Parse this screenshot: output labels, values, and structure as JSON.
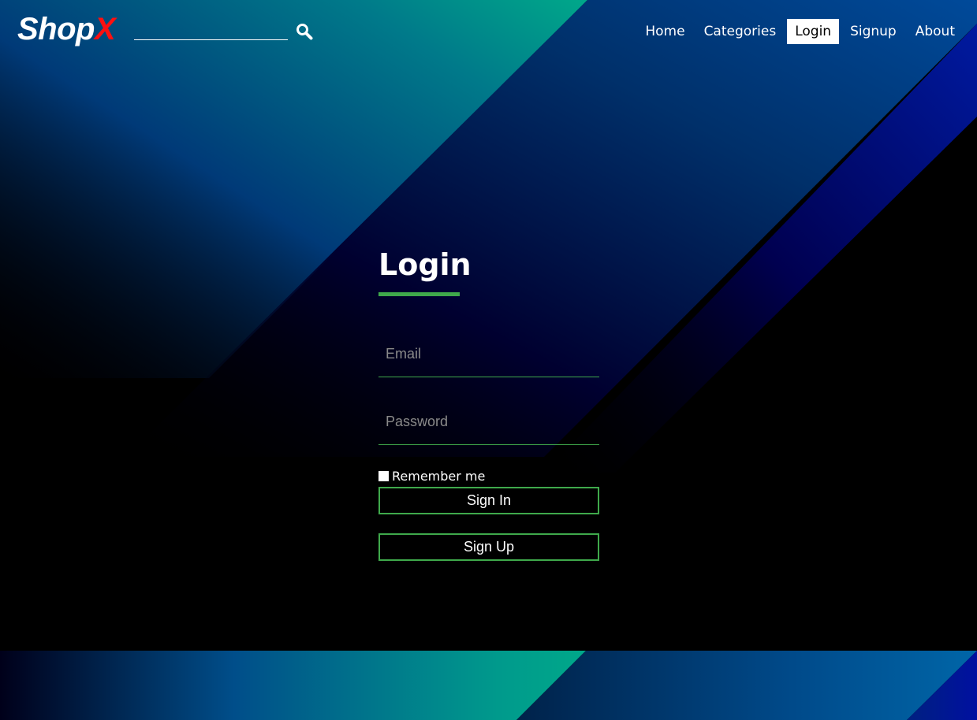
{
  "brand": {
    "logo_main": "Shop",
    "logo_accent": "X",
    "accent_color": "#ff1010",
    "green_color": "#3fa94b"
  },
  "search": {
    "placeholder": "",
    "value": "",
    "icon": "search-icon"
  },
  "nav": {
    "items": [
      {
        "label": "Home",
        "active": false
      },
      {
        "label": "Categories",
        "active": false
      },
      {
        "label": "Login",
        "active": true
      },
      {
        "label": "Signup",
        "active": false
      },
      {
        "label": "About",
        "active": false
      }
    ]
  },
  "login": {
    "title": "Login",
    "email_placeholder": "Email",
    "password_placeholder": "Password",
    "remember_label": "Remember me",
    "remember_checked": false,
    "signin_label": "Sign In",
    "signup_label": "Sign Up"
  }
}
